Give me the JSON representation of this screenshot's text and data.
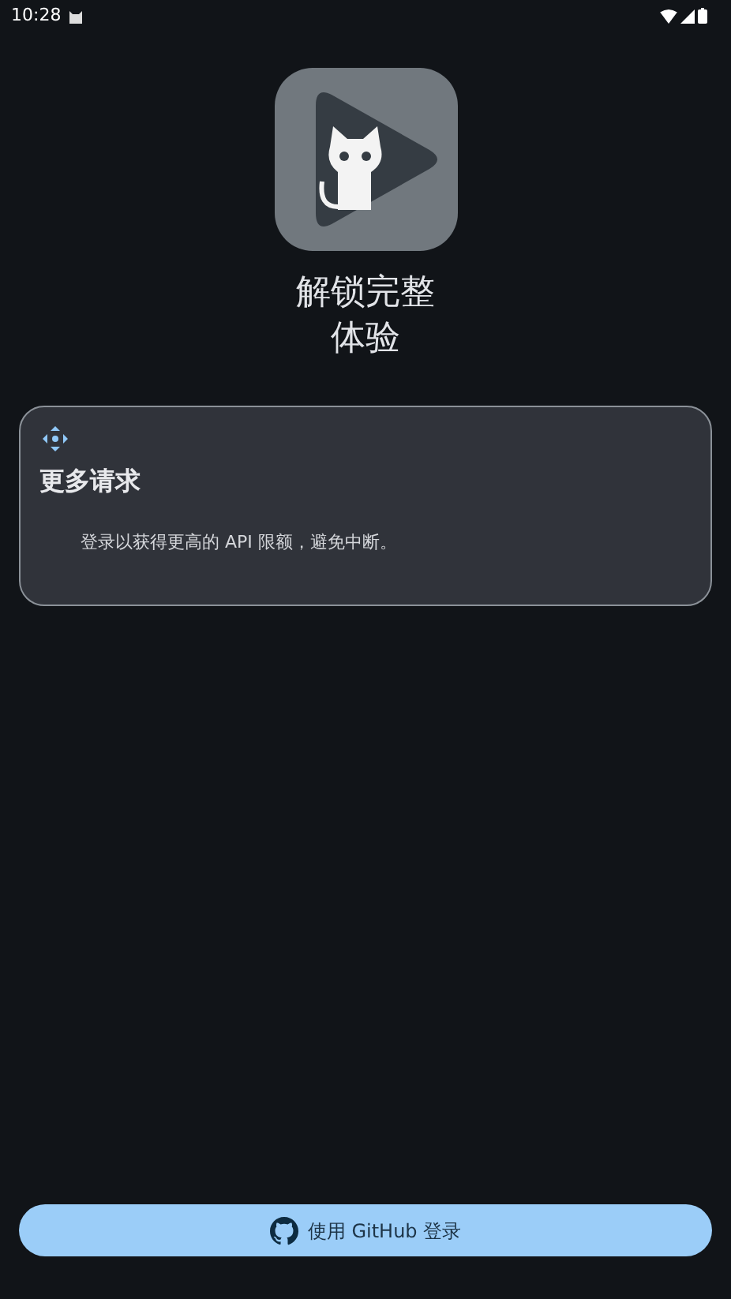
{
  "status_bar": {
    "time": "10:28"
  },
  "title": "解锁完整体验",
  "card": {
    "heading": "更多请求",
    "body": "登录以获得更高的 API 限额，避免中断。"
  },
  "login_button": {
    "label": "使用 GitHub 登录"
  }
}
